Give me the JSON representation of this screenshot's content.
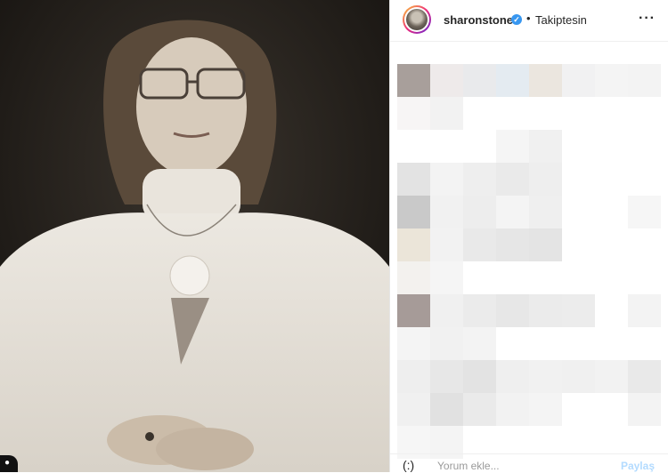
{
  "header": {
    "username": "sharonstone",
    "separator": "•",
    "follow_status": "Takiptesin",
    "more_label": "···",
    "verified_mark": "✓"
  },
  "footer": {
    "emoji_label": "(:)",
    "comment_placeholder": "Yorum ekle...",
    "share_label": "Paylaş"
  },
  "icons": {
    "verified": "verified-badge-icon",
    "more": "more-options-icon",
    "emoji": "emoji-icon",
    "user": "user-icon"
  },
  "colors": {
    "verified": "#3897f0",
    "share_disabled": "#b3dbff",
    "text": "#262626"
  }
}
